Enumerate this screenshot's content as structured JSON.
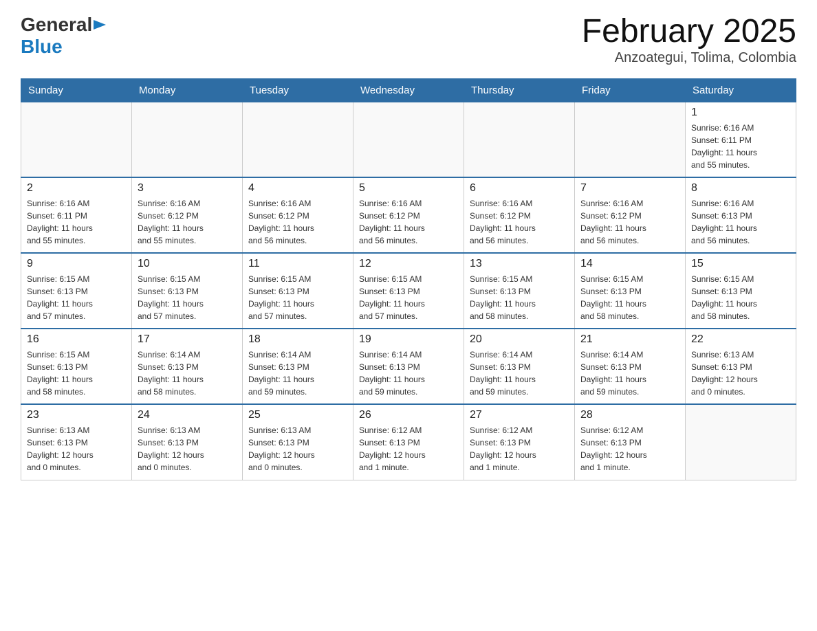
{
  "header": {
    "logo_general": "General",
    "logo_blue": "Blue",
    "month_title": "February 2025",
    "location": "Anzoategui, Tolima, Colombia"
  },
  "days_of_week": [
    "Sunday",
    "Monday",
    "Tuesday",
    "Wednesday",
    "Thursday",
    "Friday",
    "Saturday"
  ],
  "weeks": [
    [
      {
        "day": "",
        "info": ""
      },
      {
        "day": "",
        "info": ""
      },
      {
        "day": "",
        "info": ""
      },
      {
        "day": "",
        "info": ""
      },
      {
        "day": "",
        "info": ""
      },
      {
        "day": "",
        "info": ""
      },
      {
        "day": "1",
        "info": "Sunrise: 6:16 AM\nSunset: 6:11 PM\nDaylight: 11 hours\nand 55 minutes."
      }
    ],
    [
      {
        "day": "2",
        "info": "Sunrise: 6:16 AM\nSunset: 6:11 PM\nDaylight: 11 hours\nand 55 minutes."
      },
      {
        "day": "3",
        "info": "Sunrise: 6:16 AM\nSunset: 6:12 PM\nDaylight: 11 hours\nand 55 minutes."
      },
      {
        "day": "4",
        "info": "Sunrise: 6:16 AM\nSunset: 6:12 PM\nDaylight: 11 hours\nand 56 minutes."
      },
      {
        "day": "5",
        "info": "Sunrise: 6:16 AM\nSunset: 6:12 PM\nDaylight: 11 hours\nand 56 minutes."
      },
      {
        "day": "6",
        "info": "Sunrise: 6:16 AM\nSunset: 6:12 PM\nDaylight: 11 hours\nand 56 minutes."
      },
      {
        "day": "7",
        "info": "Sunrise: 6:16 AM\nSunset: 6:12 PM\nDaylight: 11 hours\nand 56 minutes."
      },
      {
        "day": "8",
        "info": "Sunrise: 6:16 AM\nSunset: 6:13 PM\nDaylight: 11 hours\nand 56 minutes."
      }
    ],
    [
      {
        "day": "9",
        "info": "Sunrise: 6:15 AM\nSunset: 6:13 PM\nDaylight: 11 hours\nand 57 minutes."
      },
      {
        "day": "10",
        "info": "Sunrise: 6:15 AM\nSunset: 6:13 PM\nDaylight: 11 hours\nand 57 minutes."
      },
      {
        "day": "11",
        "info": "Sunrise: 6:15 AM\nSunset: 6:13 PM\nDaylight: 11 hours\nand 57 minutes."
      },
      {
        "day": "12",
        "info": "Sunrise: 6:15 AM\nSunset: 6:13 PM\nDaylight: 11 hours\nand 57 minutes."
      },
      {
        "day": "13",
        "info": "Sunrise: 6:15 AM\nSunset: 6:13 PM\nDaylight: 11 hours\nand 58 minutes."
      },
      {
        "day": "14",
        "info": "Sunrise: 6:15 AM\nSunset: 6:13 PM\nDaylight: 11 hours\nand 58 minutes."
      },
      {
        "day": "15",
        "info": "Sunrise: 6:15 AM\nSunset: 6:13 PM\nDaylight: 11 hours\nand 58 minutes."
      }
    ],
    [
      {
        "day": "16",
        "info": "Sunrise: 6:15 AM\nSunset: 6:13 PM\nDaylight: 11 hours\nand 58 minutes."
      },
      {
        "day": "17",
        "info": "Sunrise: 6:14 AM\nSunset: 6:13 PM\nDaylight: 11 hours\nand 58 minutes."
      },
      {
        "day": "18",
        "info": "Sunrise: 6:14 AM\nSunset: 6:13 PM\nDaylight: 11 hours\nand 59 minutes."
      },
      {
        "day": "19",
        "info": "Sunrise: 6:14 AM\nSunset: 6:13 PM\nDaylight: 11 hours\nand 59 minutes."
      },
      {
        "day": "20",
        "info": "Sunrise: 6:14 AM\nSunset: 6:13 PM\nDaylight: 11 hours\nand 59 minutes."
      },
      {
        "day": "21",
        "info": "Sunrise: 6:14 AM\nSunset: 6:13 PM\nDaylight: 11 hours\nand 59 minutes."
      },
      {
        "day": "22",
        "info": "Sunrise: 6:13 AM\nSunset: 6:13 PM\nDaylight: 12 hours\nand 0 minutes."
      }
    ],
    [
      {
        "day": "23",
        "info": "Sunrise: 6:13 AM\nSunset: 6:13 PM\nDaylight: 12 hours\nand 0 minutes."
      },
      {
        "day": "24",
        "info": "Sunrise: 6:13 AM\nSunset: 6:13 PM\nDaylight: 12 hours\nand 0 minutes."
      },
      {
        "day": "25",
        "info": "Sunrise: 6:13 AM\nSunset: 6:13 PM\nDaylight: 12 hours\nand 0 minutes."
      },
      {
        "day": "26",
        "info": "Sunrise: 6:12 AM\nSunset: 6:13 PM\nDaylight: 12 hours\nand 1 minute."
      },
      {
        "day": "27",
        "info": "Sunrise: 6:12 AM\nSunset: 6:13 PM\nDaylight: 12 hours\nand 1 minute."
      },
      {
        "day": "28",
        "info": "Sunrise: 6:12 AM\nSunset: 6:13 PM\nDaylight: 12 hours\nand 1 minute."
      },
      {
        "day": "",
        "info": ""
      }
    ]
  ]
}
